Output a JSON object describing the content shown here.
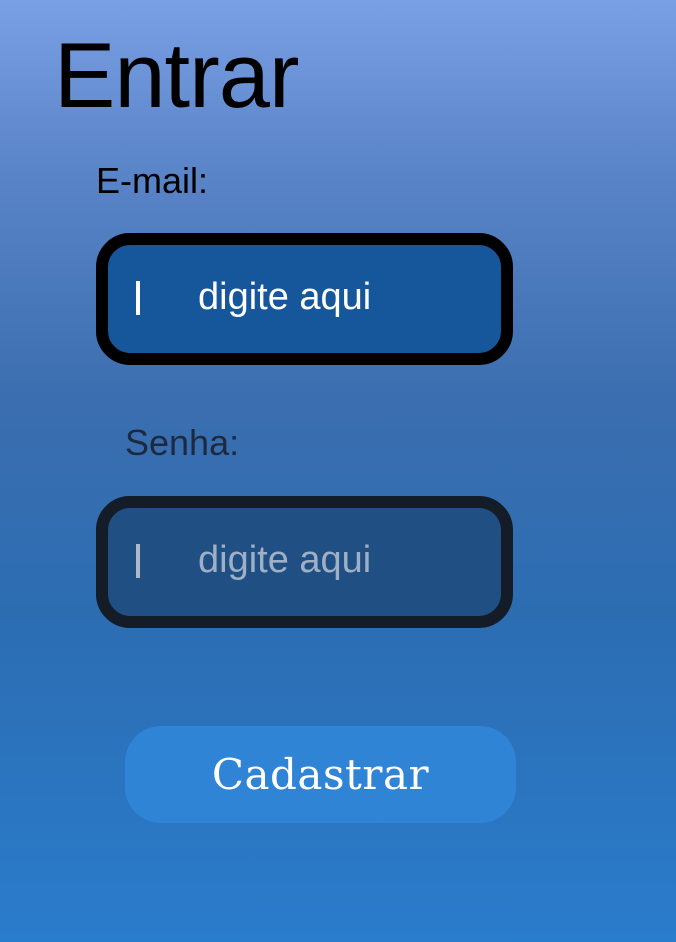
{
  "page": {
    "title": "Entrar"
  },
  "form": {
    "email": {
      "label": "E-mail:",
      "placeholder": "digite aqui",
      "caret_icon": "text-cursor-icon"
    },
    "senha": {
      "label": "Senha:",
      "placeholder": "digite aqui",
      "caret_icon": "text-cursor-icon"
    },
    "submit_label": "Cadastrar"
  },
  "colors": {
    "background_top": "#7a9fe4",
    "background_bottom": "#2a7ccc",
    "email_field_fill": "#16569a",
    "senha_field_fill": "#204f84",
    "button_fill": "#2f84d6"
  }
}
